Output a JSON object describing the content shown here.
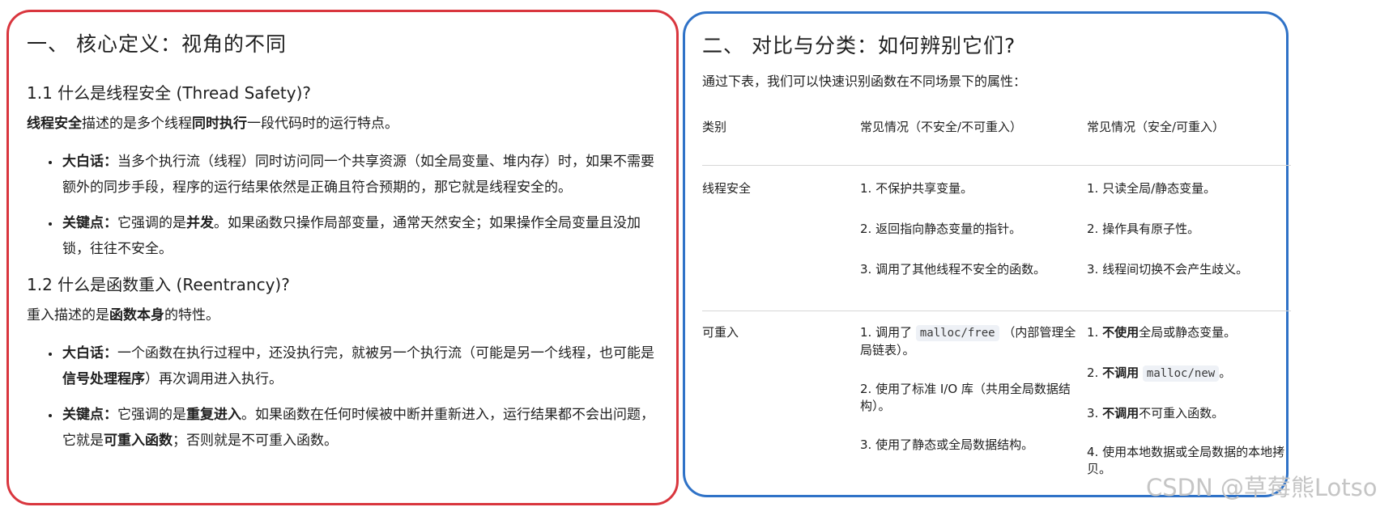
{
  "left": {
    "title": "一、 核心定义：视角的不同",
    "s1": {
      "heading": "1.1 什么是线程安全 (Thread Safety)?",
      "desc_b1": "线程安全",
      "desc_t1": "描述的是多个线程",
      "desc_b2": "同时执行",
      "desc_t2": "一段代码时的运行特点。",
      "items": [
        {
          "label": "大白话：",
          "text": "当多个执行流（线程）同时访问同一个共享资源（如全局变量、堆内存）时，如果不需要额外的同步手段，程序的运行结果依然是正确且符合预期的，那它就是线程安全的。"
        },
        {
          "label": "关键点：",
          "pre": "它强调的是",
          "bold": "并发",
          "post": "。如果函数只操作局部变量，通常天然安全；如果操作全局变量且没加锁，往往不安全。"
        }
      ]
    },
    "s2": {
      "heading": "1.2 什么是函数重入 (Reentrancy)?",
      "desc_t1": "重入描述的是",
      "desc_b1": "函数本身",
      "desc_t2": "的特性。",
      "items": [
        {
          "label": "大白话：",
          "pre": "一个函数在执行过程中，还没执行完，就被另一个执行流（可能是另一个线程，也可能是",
          "bold": "信号处理程序",
          "post": "）再次调用进入执行。"
        },
        {
          "label": "关键点：",
          "pre": "它强调的是",
          "bold": "重复进入",
          "mid": "。如果函数在任何时候被中断并重新进入，运行结果都不会出问题，它就是",
          "bold2": "可重入函数",
          "post": "；否则就是不可重入函数。"
        }
      ]
    }
  },
  "right": {
    "title": "二、 对比与分类：如何辨别它们?",
    "intro": "通过下表，我们可以快速识别函数在不同场景下的属性：",
    "headers": [
      "类别",
      "常见情况（不安全/不可重入）",
      "常见情况（安全/可重入）"
    ],
    "row_a": {
      "category": "线程安全",
      "unsafe": [
        "1. 不保护共享变量。",
        "2. 返回指向静态变量的指针。",
        "3. 调用了其他线程不安全的函数。"
      ],
      "safe": [
        "1. 只读全局/静态变量。",
        "2. 操作具有原子性。",
        "3. 线程间切换不会产生歧义。"
      ]
    },
    "row_b": {
      "category": "可重入",
      "unsafe_1_pre": "1. 调用了",
      "unsafe_1_code": "malloc/free",
      "unsafe_1_post": "（内部管理全局链表）。",
      "unsafe_2": "2. 使用了标准 I/O 库（共用全局数据结构）。",
      "unsafe_3": "3. 使用了静态或全局数据结构。",
      "safe_1_num": "1. ",
      "safe_1_bold": "不使用",
      "safe_1_post": "全局或静态变量。",
      "safe_2_num": "2. ",
      "safe_2_bold": "不调用",
      "safe_2_code": "malloc/new",
      "safe_2_post": "。",
      "safe_3_num": "3. ",
      "safe_3_bold": "不调用",
      "safe_3_post": "不可重入函数。",
      "safe_4": "4. 使用本地数据或全局数据的本地拷贝。"
    }
  },
  "watermark": "CSDN @草莓熊Lotso"
}
